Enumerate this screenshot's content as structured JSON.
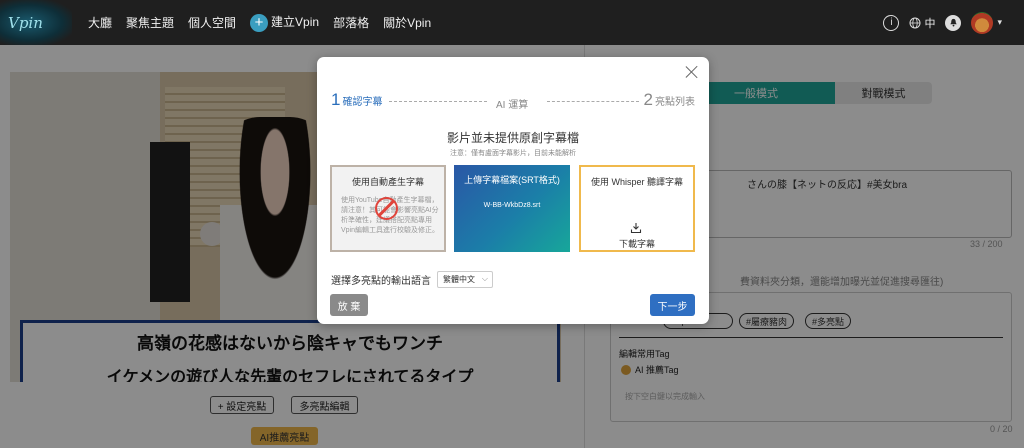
{
  "nav": {
    "logo_text": "Vpin",
    "items": [
      "大廳",
      "聚焦主題",
      "個人空間",
      "建立Vpin",
      "部落格",
      "關於Vpin"
    ],
    "lang": "中",
    "info_glyph": "i",
    "icons": [
      "info-icon",
      "globe-icon",
      "bell-icon",
      "avatar"
    ]
  },
  "video": {
    "subtitle_line1": "高嶺の花感はないから陰キャでもワンチ",
    "subtitle_line2": "イケメンの遊び人な先輩のセフレにされてるタイプ"
  },
  "below_video": {
    "set_highlight": "+ 設定亮點",
    "multi_edit": "多亮點編輯",
    "ai_recommend": "AI推薦亮點"
  },
  "right_panel": {
    "mode_general": "一般模式",
    "mode_battle": "對戰模式",
    "title_value": "さんの膝【ネットの反応】#美女bra",
    "title_count": "33 / 200",
    "hint": "費資料夾分類，還能增加曝光並促進搜尋匯往)",
    "tags": [
      "ecipe",
      "#屬療豬肉",
      "#多亮點"
    ],
    "common_tag_label": "編輯常用Tag",
    "ai_tag": "AI 推薦Tag",
    "tag_input_hint": "按下空白鍵以完成輸入",
    "tag_count": "0 / 20"
  },
  "modal": {
    "step1_num": "1",
    "step1_label": "確認字幕",
    "step2_label": "AI 運算",
    "step3_num": "2",
    "step3_label": "亮點列表",
    "title": "影片並未提供原創字幕檔",
    "note": "注意：僅有盧面字幕影片，目前未能解析",
    "card_auto_title": "使用自動產生字幕",
    "card_auto_body": "使用YouTube自動產生字幕檔，請注意！其可能會影響亮點AI分析準確性，建議搭配亮點專用Vpin編輯工具進行校驗及修正。",
    "card_upload_title": "上傳字幕檔案(SRT格式)",
    "card_upload_file": "W-BB-WkbDz8.srt",
    "card_whisper_title": "使用 Whisper 聽譯字幕",
    "card_whisper_action": "下載字幕",
    "lang_label": "選擇多亮點的輸出語言",
    "lang_value": "繁體中文",
    "cancel": "放 棄",
    "next": "下一步"
  },
  "colors": {
    "accent_blue": "#2f6fc2",
    "teal": "#20a79a",
    "orange": "#f0b94c",
    "nav_bg": "#1f1f1f"
  }
}
